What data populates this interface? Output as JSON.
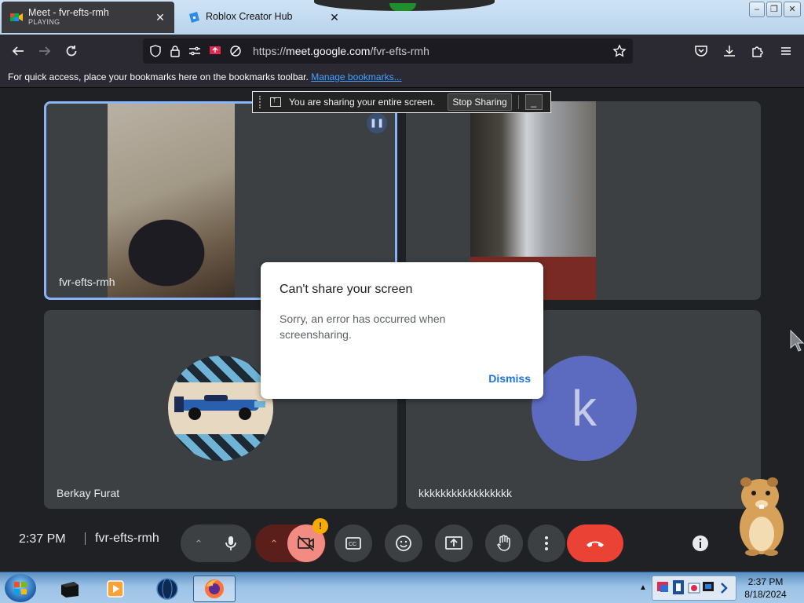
{
  "browser": {
    "tabs": [
      {
        "title": "Meet - fvr-efts-rmh",
        "subtitle": "PLAYING",
        "active": true
      },
      {
        "title": "Roblox Creator Hub",
        "active": false
      }
    ],
    "url_prefix": "https://",
    "url_host": "meet.google.com",
    "url_path": "/fvr-efts-rmh",
    "bookmarks_text": "For quick access, place your bookmarks here on the bookmarks toolbar.",
    "bookmarks_link": "Manage bookmarks...",
    "window_controls": {
      "minimize": "–",
      "restore": "❐",
      "close": "✕"
    }
  },
  "share_banner": {
    "text": "You are sharing your entire screen.",
    "stop_label": "Stop Sharing",
    "minimize_label": "_"
  },
  "tiles": [
    {
      "name": "fvr-efts-rmh"
    },
    {
      "name": ""
    },
    {
      "name": "Berkay Furat"
    },
    {
      "name": "kkkkkkkkkkkkkkkkk",
      "initial": "k"
    }
  ],
  "dialog": {
    "title": "Can't share your screen",
    "message": "Sorry, an error has occurred when screensharing.",
    "dismiss_label": "Dismiss"
  },
  "meet_controls": {
    "time": "2:37 PM",
    "meeting_code": "fvr-efts-rmh",
    "camera_warning": "!"
  },
  "colors": {
    "accent": "#1a73e8",
    "tile_bg": "#3c4043",
    "end_call": "#ea4335",
    "camera_off": "#f28b82",
    "active_border": "#8ab4f8"
  },
  "taskbar": {
    "time": "2:37 PM",
    "date": "8/18/2024"
  }
}
